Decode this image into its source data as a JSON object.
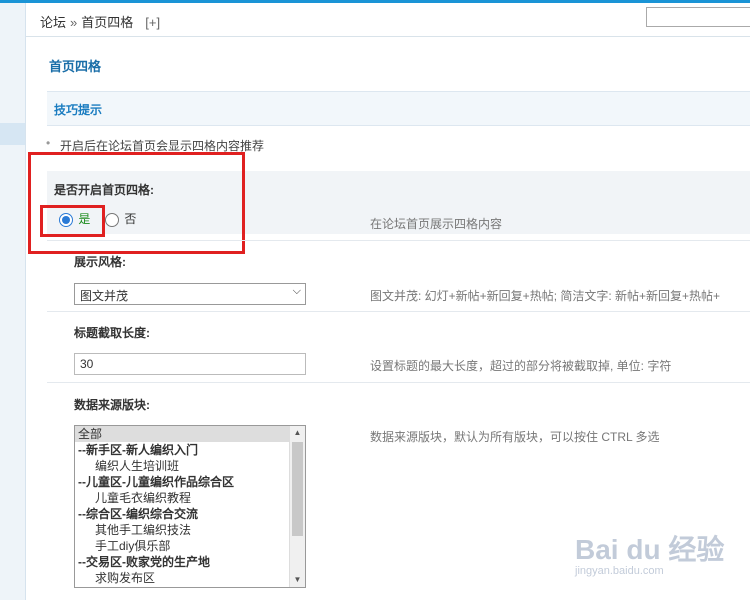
{
  "breadcrumb": {
    "root": "论坛",
    "sep": "»",
    "current": "首页四格",
    "add": "[+]"
  },
  "page_title": "首页四格",
  "tips": {
    "title": "技巧提示",
    "item": "开启后在论坛首页会显示四格内容推荐"
  },
  "settings": {
    "enable": {
      "label": "是否开启首页四格:",
      "yes": "是",
      "no": "否",
      "selected": "是",
      "hint": "在论坛首页展示四格内容"
    },
    "style": {
      "label": "展示风格:",
      "value": "图文并茂",
      "hint": "图文并茂: 幻灯+新帖+新回复+热帖; 简洁文字: 新帖+新回复+热帖+"
    },
    "title_length": {
      "label": "标题截取长度:",
      "value": "30",
      "hint": "设置标题的最大长度，超过的部分将被截取掉, 单位: 字符"
    },
    "source": {
      "label": "数据来源版块:",
      "hint": "数据来源版块，默认为所有版块，可以按住 CTRL 多选",
      "options": [
        "全部",
        "--新手区-新人编织入门",
        "编织人生培训班",
        "--儿童区-儿童编织作品综合区",
        "儿童毛衣编织教程",
        "--综合区-编织综合交流",
        "其他手工编织技法",
        "手工diy俱乐部",
        "--交易区-败家党的生产地",
        "求购发布区"
      ]
    }
  },
  "watermark": {
    "logo": "Bai du 经验",
    "url": "jingyan.baidu.com"
  }
}
